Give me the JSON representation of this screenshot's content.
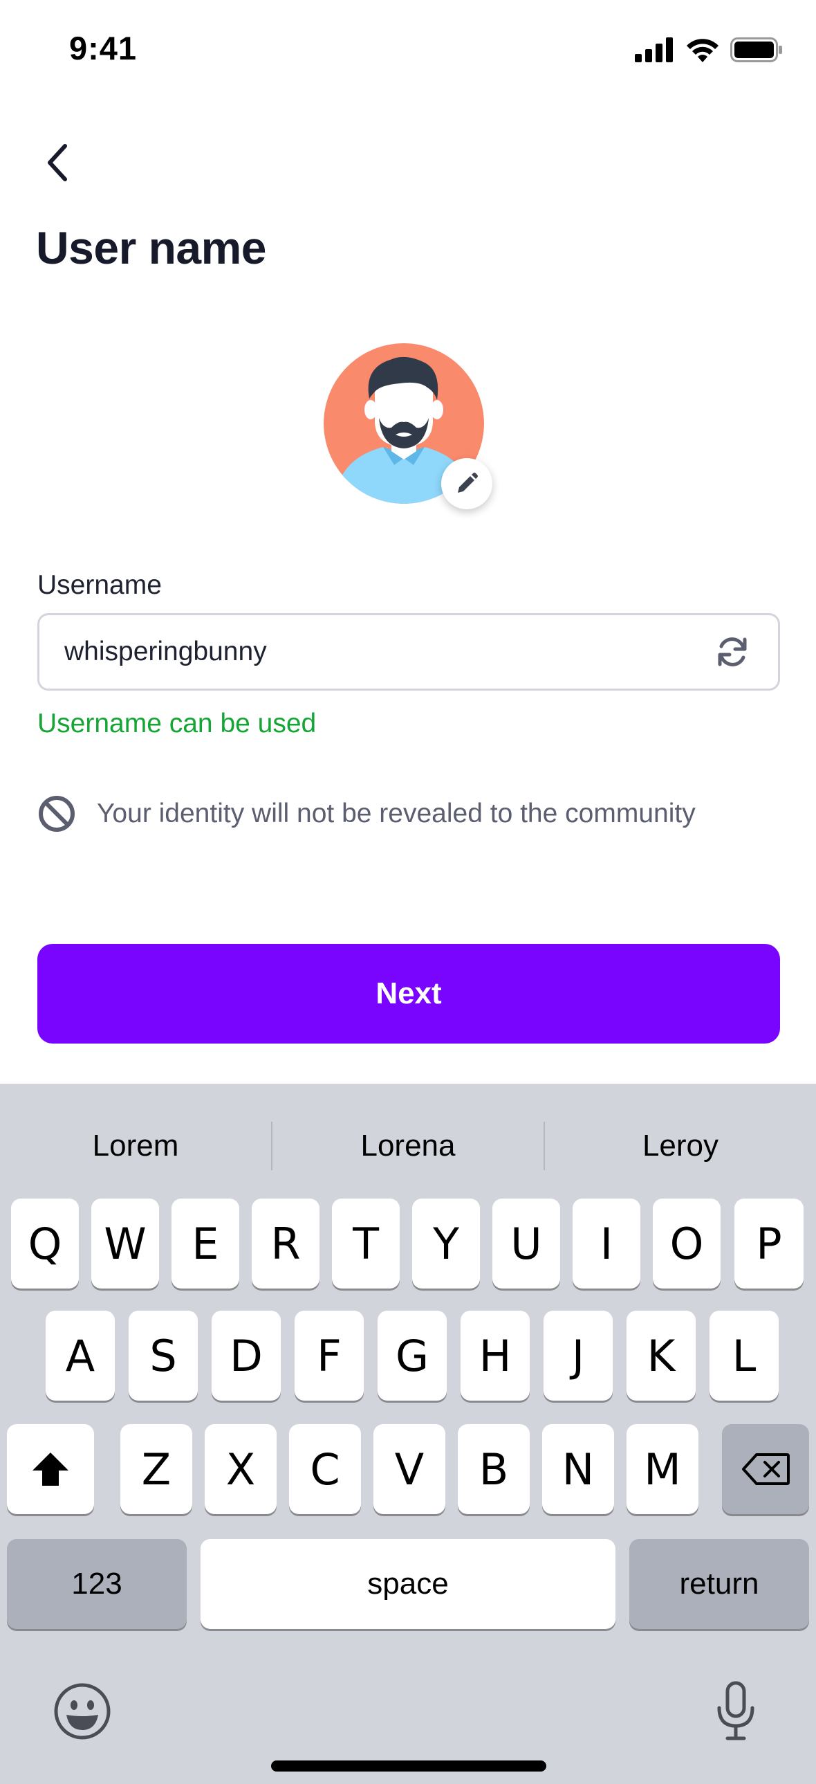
{
  "status_bar": {
    "time": "9:41",
    "icons": [
      "signal-icon",
      "wifi-icon",
      "battery-icon"
    ]
  },
  "header": {
    "back_icon": "chevron-left-icon",
    "title": "User name"
  },
  "avatar": {
    "background": "#fa8a6c",
    "edit_icon": "pencil-icon"
  },
  "form": {
    "username_label": "Username",
    "username_value": "whisperingbunny",
    "refresh_icon": "refresh-icon",
    "status_message": "Username can be used",
    "status_color": "#14a534"
  },
  "notice": {
    "icon": "prohibited-icon",
    "text": "Your identity will not be revealed to the community"
  },
  "primary_button": {
    "label": "Next",
    "color": "#7a05ff"
  },
  "keyboard": {
    "suggestions": [
      "Lorem",
      "Lorena",
      "Leroy"
    ],
    "row1": [
      "Q",
      "W",
      "E",
      "R",
      "T",
      "Y",
      "U",
      "I",
      "O",
      "P"
    ],
    "row2": [
      "A",
      "S",
      "D",
      "F",
      "G",
      "H",
      "J",
      "K",
      "L"
    ],
    "row3": [
      "Z",
      "X",
      "C",
      "V",
      "B",
      "N",
      "M"
    ],
    "numbers_label": "123",
    "space_label": "space",
    "return_label": "return",
    "icons": [
      "shift-icon",
      "backspace-icon",
      "emoji-icon",
      "microphone-icon"
    ]
  }
}
